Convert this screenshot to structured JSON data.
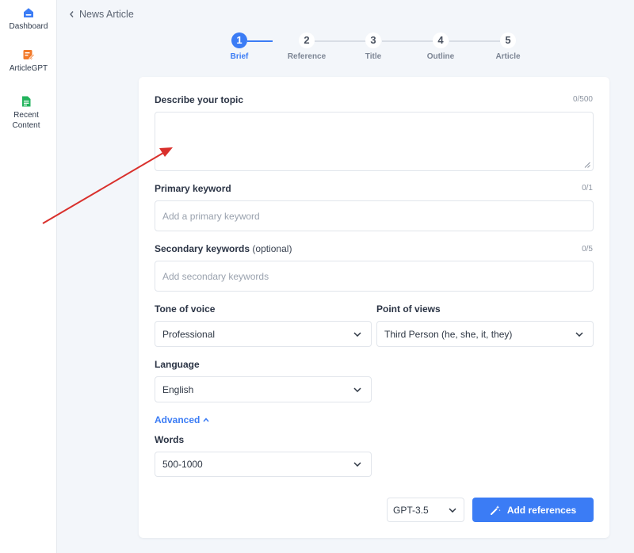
{
  "sidebar": {
    "items": [
      {
        "label": "Dashboard",
        "icon": "home-icon",
        "color": "#3b7cf5"
      },
      {
        "label": "ArticleGPT",
        "icon": "edit-icon",
        "color": "#f27a2a"
      },
      {
        "label": "Recent Content",
        "icon": "document-icon",
        "color": "#22b35c"
      }
    ]
  },
  "header": {
    "back_label": "News Article"
  },
  "steps": [
    {
      "number": "1",
      "label": "Brief",
      "active": true
    },
    {
      "number": "2",
      "label": "Reference",
      "active": false
    },
    {
      "number": "3",
      "label": "Title",
      "active": false
    },
    {
      "number": "4",
      "label": "Outline",
      "active": false
    },
    {
      "number": "5",
      "label": "Article",
      "active": false
    }
  ],
  "form": {
    "topic": {
      "label": "Describe your topic",
      "counter": "0/500",
      "value": ""
    },
    "primary_keyword": {
      "label": "Primary keyword",
      "counter": "0/1",
      "placeholder": "Add a primary keyword"
    },
    "secondary_keywords": {
      "label": "Secondary keywords",
      "optional": "(optional)",
      "counter": "0/5",
      "placeholder": "Add secondary keywords"
    },
    "tone": {
      "label": "Tone of voice",
      "value": "Professional"
    },
    "point_of_view": {
      "label": "Point of views",
      "value": "Third Person (he, she, it, they)"
    },
    "language": {
      "label": "Language",
      "value": "English"
    },
    "advanced_label": "Advanced",
    "words": {
      "label": "Words",
      "value": "500-1000"
    },
    "model": {
      "value": "GPT-3.5"
    },
    "submit_label": "Add references"
  },
  "colors": {
    "accent": "#3b7cf5",
    "annotation_arrow": "#d9302c"
  }
}
